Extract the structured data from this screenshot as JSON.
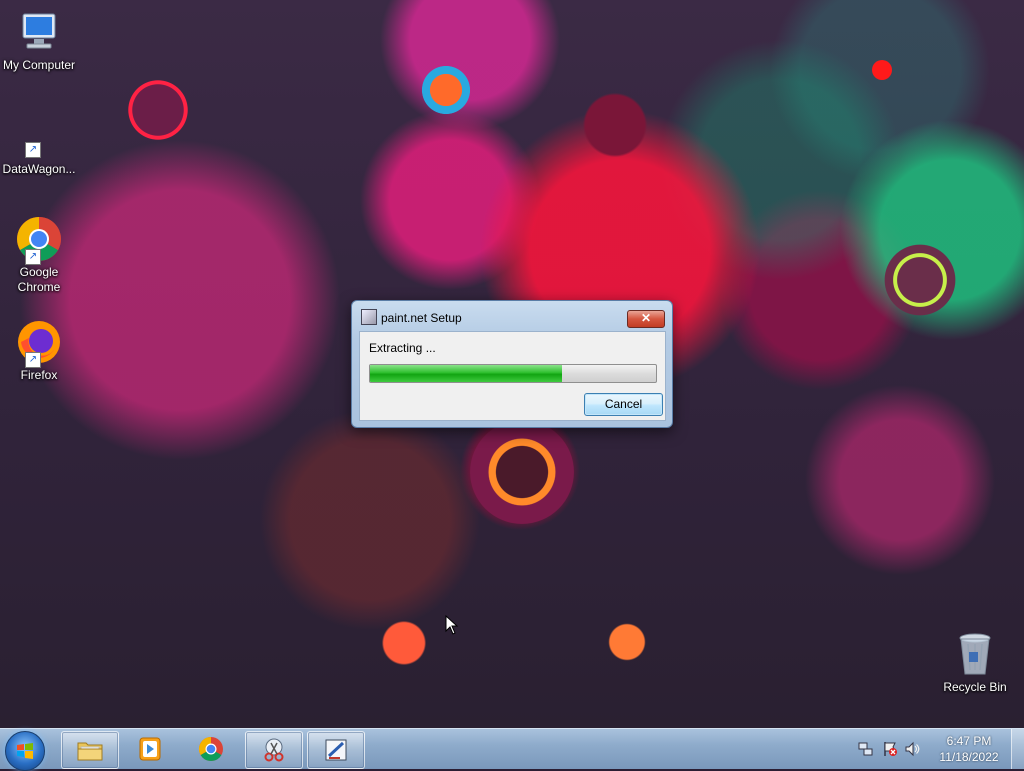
{
  "desktop": {
    "icons": [
      {
        "label": "My Computer",
        "icon": "computer-icon",
        "shortcut": false
      },
      {
        "label": "DataWagon...",
        "icon": "datawagon-icon",
        "shortcut": true
      },
      {
        "label": "Google Chrome",
        "icon": "chrome-icon",
        "shortcut": true
      },
      {
        "label": "Firefox",
        "icon": "firefox-icon",
        "shortcut": true
      },
      {
        "label": "Recycle Bin",
        "icon": "recycle-bin-icon",
        "shortcut": false
      }
    ]
  },
  "dialog": {
    "title": "paint.net Setup",
    "close_glyph": "✕",
    "status": "Extracting ...",
    "progress_percent": 67,
    "cancel_label": "Cancel"
  },
  "taskbar": {
    "start_icon": "windows-start-icon",
    "pinned": [
      {
        "name": "file-explorer",
        "icon": "folder-icon",
        "active": true
      },
      {
        "name": "media-player",
        "icon": "media-player-icon",
        "active": false
      },
      {
        "name": "chrome",
        "icon": "chrome-icon",
        "active": false
      },
      {
        "name": "snipping-tool",
        "icon": "scissors-icon",
        "active": true
      },
      {
        "name": "paint-net-setup",
        "icon": "paint-net-icon",
        "active": true
      }
    ],
    "tray": {
      "icons": [
        "network-icon",
        "action-center-flag-icon",
        "volume-icon"
      ],
      "time": "6:47 PM",
      "date": "11/18/2022"
    }
  },
  "colors": {
    "taskbar": "#8eabcb",
    "progress_green": "#12a412",
    "close_red": "#c13c23"
  }
}
